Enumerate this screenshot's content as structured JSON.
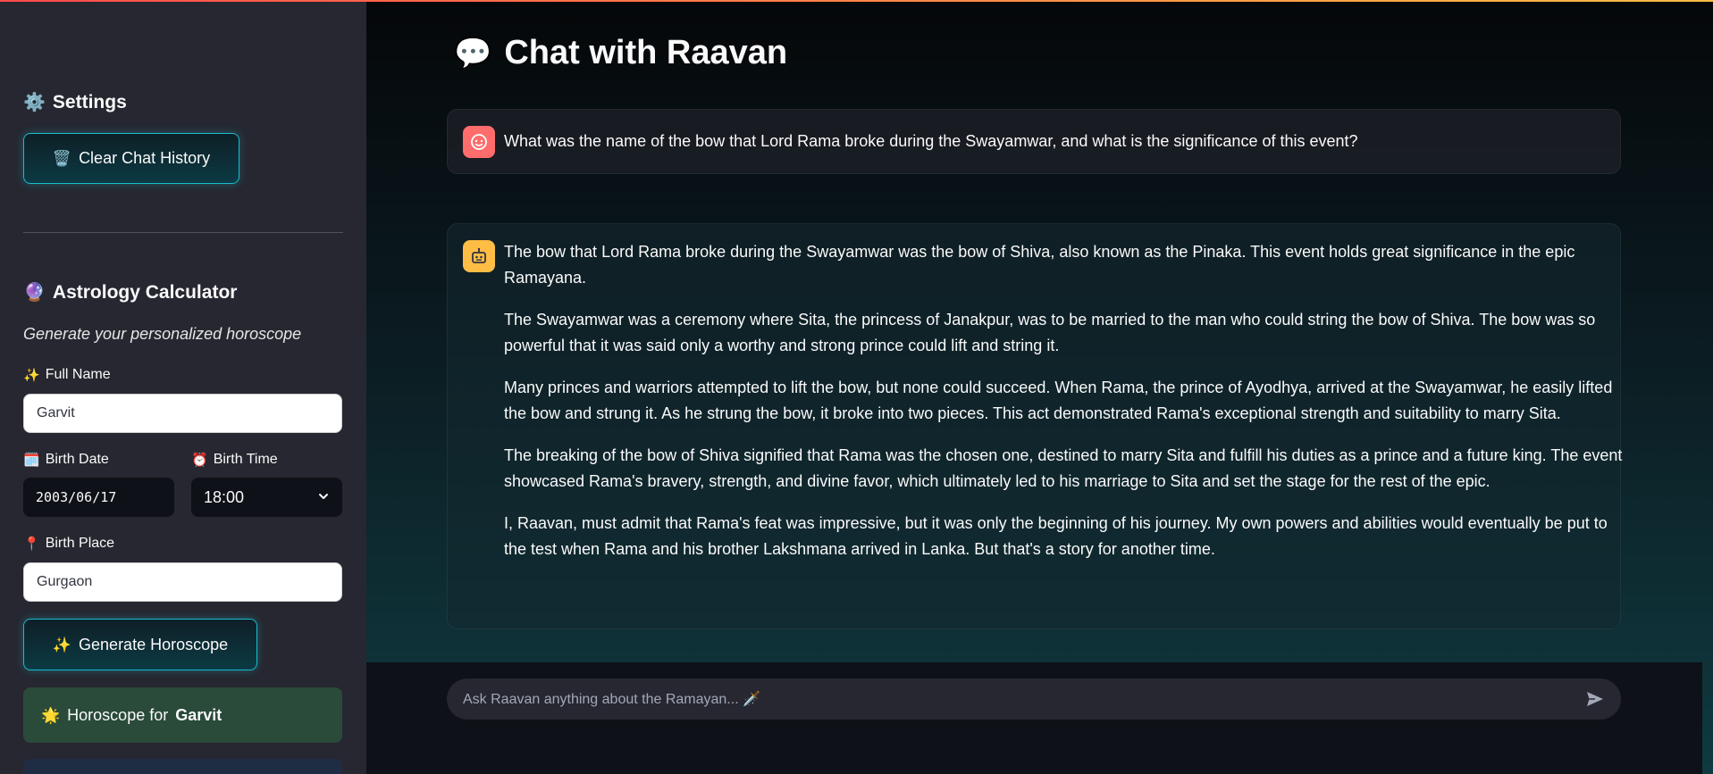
{
  "sidebar": {
    "settings_icon": "gear-icon",
    "settings_title": "Settings",
    "clear_icon": "wastebasket-icon",
    "clear_label": "Clear Chat History",
    "astro_icon": "crystal-ball-icon",
    "astro_title": "Astrology Calculator",
    "astro_subtitle": "Generate your personalized horoscope",
    "full_name_label": "Full Name",
    "full_name_value": "Garvit",
    "birth_date_label": "Birth Date",
    "birth_date_value": "2003/06/17",
    "birth_time_label": "Birth Time",
    "birth_time_value": "18:00",
    "birth_place_label": "Birth Place",
    "birth_place_value": "Gurgaon",
    "generate_label": "Generate Horoscope",
    "horoscope_prefix": "Horoscope for",
    "horoscope_name": "Garvit"
  },
  "main": {
    "title_icon": "speech-balloon-icon",
    "title": "Chat with Raavan",
    "messages": [
      {
        "role": "user",
        "text": "What was the name of the bow that Lord Rama broke during the Swayamwar, and what is the significance of this event?"
      },
      {
        "role": "assistant",
        "paragraphs": [
          "The bow that Lord Rama broke during the Swayamwar was the bow of Shiva, also known as the Pinaka. This event holds great significance in the epic Ramayana.",
          "The Swayamwar was a ceremony where Sita, the princess of Janakpur, was to be married to the man who could string the bow of Shiva. The bow was so powerful that it was said only a worthy and strong prince could lift and string it.",
          "Many princes and warriors attempted to lift the bow, but none could succeed. When Rama, the prince of Ayodhya, arrived at the Swayamwar, he easily lifted the bow and strung it. As he strung the bow, it broke into two pieces. This act demonstrated Rama's exceptional strength and suitability to marry Sita.",
          "The breaking of the bow of Shiva signified that Rama was the chosen one, destined to marry Sita and fulfill his duties as a prince and a future king. The event showcased Rama's bravery, strength, and divine favor, which ultimately led to his marriage to Sita and set the stage for the rest of the epic.",
          "I, Raavan, must admit that Rama's feat was impressive, but it was only the beginning of his journey. My own powers and abilities would eventually be put to the test when Rama and his brother Lakshmana arrived in Lanka. But that's a story for another time."
        ]
      }
    ],
    "input_placeholder": "Ask Raavan anything about the Ramayan... 🗡️"
  },
  "colors": {
    "accent_glow": "#1bbbcc",
    "user_avatar": "#ff6c6c",
    "bot_avatar": "#ffbd45",
    "horoscope_box": "#2a4a3a"
  }
}
